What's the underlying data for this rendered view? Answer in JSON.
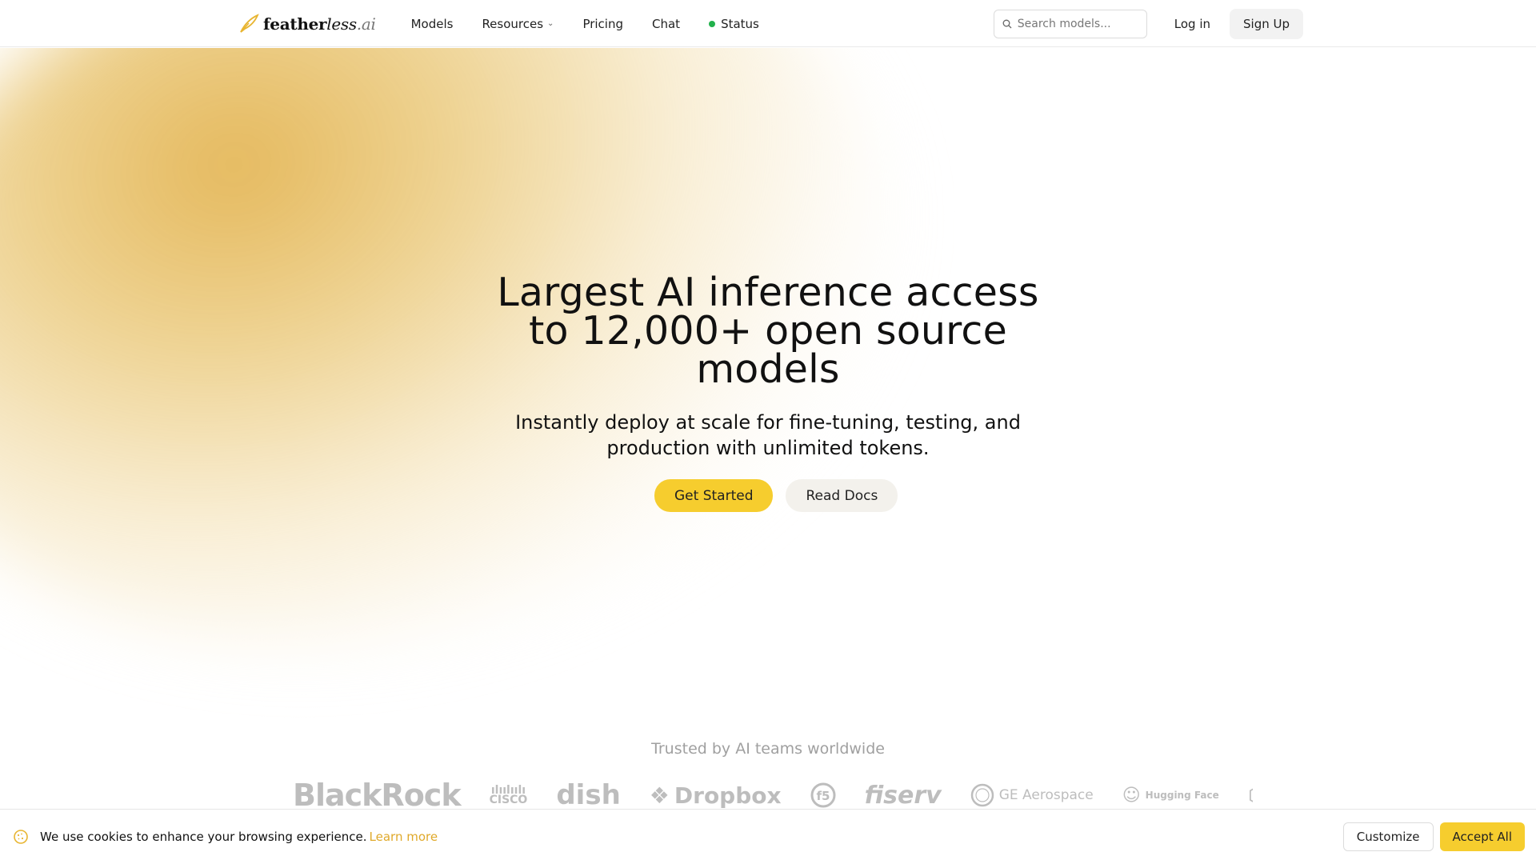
{
  "brand": {
    "name_bold": "feather",
    "name_italic": "less",
    "name_suffix": ".ai",
    "icon": "feather-icon"
  },
  "nav": {
    "items": [
      {
        "label": "Models"
      },
      {
        "label": "Resources"
      },
      {
        "label": "Pricing"
      },
      {
        "label": "Chat"
      },
      {
        "label": "Status"
      }
    ]
  },
  "search": {
    "placeholder": "Search models..."
  },
  "auth": {
    "login_label": "Log in",
    "signup_label": "Sign Up"
  },
  "hero": {
    "title": "Largest AI inference access to 12,000+ open source models",
    "subtitle": "Instantly deploy at scale for fine-tuning, testing, and production with unlimited tokens.",
    "primary_cta": "Get Started",
    "secondary_cta": "Read Docs"
  },
  "trusted": {
    "heading": "Trusted by AI teams worldwide",
    "logos": [
      "BlackRock",
      "CISCO",
      "dish",
      "Dropbox",
      "f5",
      "fiserv",
      "GE Aerospace",
      "Hugging Face",
      "Cl"
    ]
  },
  "cookie": {
    "message": "We use cookies to enhance your browsing experience.",
    "link_text": "Learn more",
    "customize_label": "Customize",
    "accept_label": "Accept All"
  },
  "colors": {
    "accent": "#f6cd2e",
    "status_online": "#22b14c",
    "link": "#e0a92a"
  }
}
